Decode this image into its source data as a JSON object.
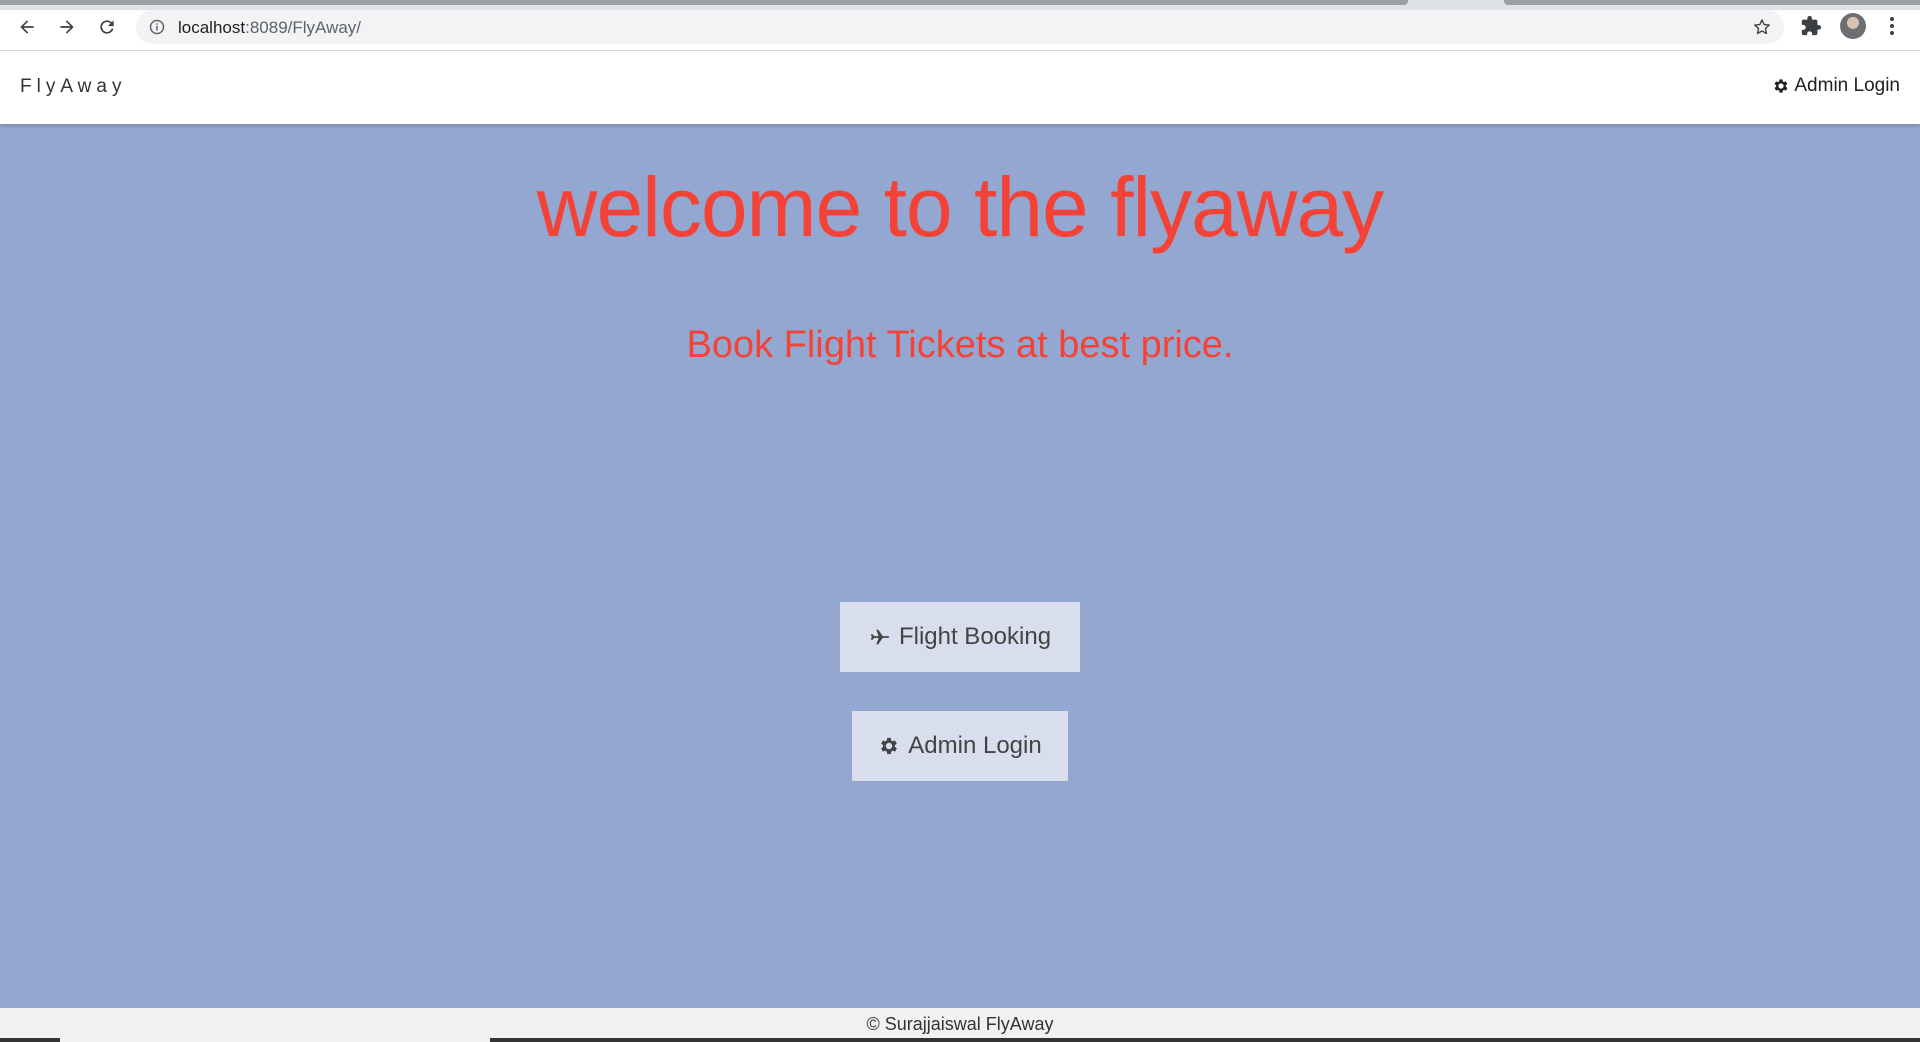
{
  "browser": {
    "url_host": "localhost",
    "url_path": ":8089/FlyAway/",
    "icons": [
      "back-arrow-icon",
      "forward-arrow-icon",
      "reload-icon",
      "info-icon",
      "star-icon",
      "puzzle-icon",
      "avatar",
      "menu-dots-icon"
    ]
  },
  "navbar": {
    "brand": "FlyAway",
    "admin_login": "Admin Login"
  },
  "hero": {
    "title": "welcome to the flyaway",
    "subtitle": "Book Flight Tickets at best price."
  },
  "buttons": {
    "flight_booking": "Flight Booking",
    "admin_login": "Admin Login"
  },
  "footer": {
    "text": "© Surajjaiswal FlyAway"
  },
  "colors": {
    "background": "#93a7d1",
    "accent": "#f44336",
    "button_bg": "#d8deed",
    "navbar_bg": "#ffffff"
  }
}
